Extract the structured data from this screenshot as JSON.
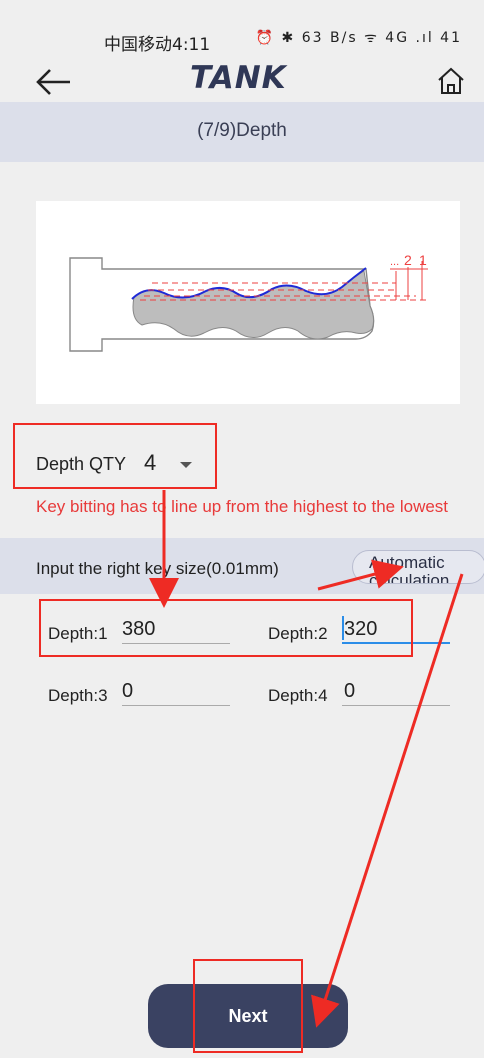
{
  "status": {
    "carrier_time": "中国移动4:11",
    "icons_text": "⏰ ✱ 63 B/s ᯤ 4G .ıl 41"
  },
  "header": {
    "logo": "TANK",
    "step_title": "(7/9)Depth"
  },
  "depth_qty": {
    "label": "Depth QTY",
    "value": "4"
  },
  "warning": "Key bitting has to line up from the highest to the lowest",
  "input_hint": "Input the right key size(0.01mm)",
  "auto_button": "Automatic calculation",
  "fields": [
    {
      "label": "Depth:1",
      "value": "380"
    },
    {
      "label": "Depth:2",
      "value": "320"
    },
    {
      "label": "Depth:3",
      "value": "0"
    },
    {
      "label": "Depth:4",
      "value": "0"
    }
  ],
  "diagram": {
    "labels": [
      "...",
      "2",
      "1"
    ]
  },
  "next_button": "Next",
  "colors": {
    "primary": "#3a4262",
    "band": "#dcdfea",
    "warning": "#e83a3a",
    "annotation": "#ee2b24",
    "focus": "#2b8de8"
  }
}
